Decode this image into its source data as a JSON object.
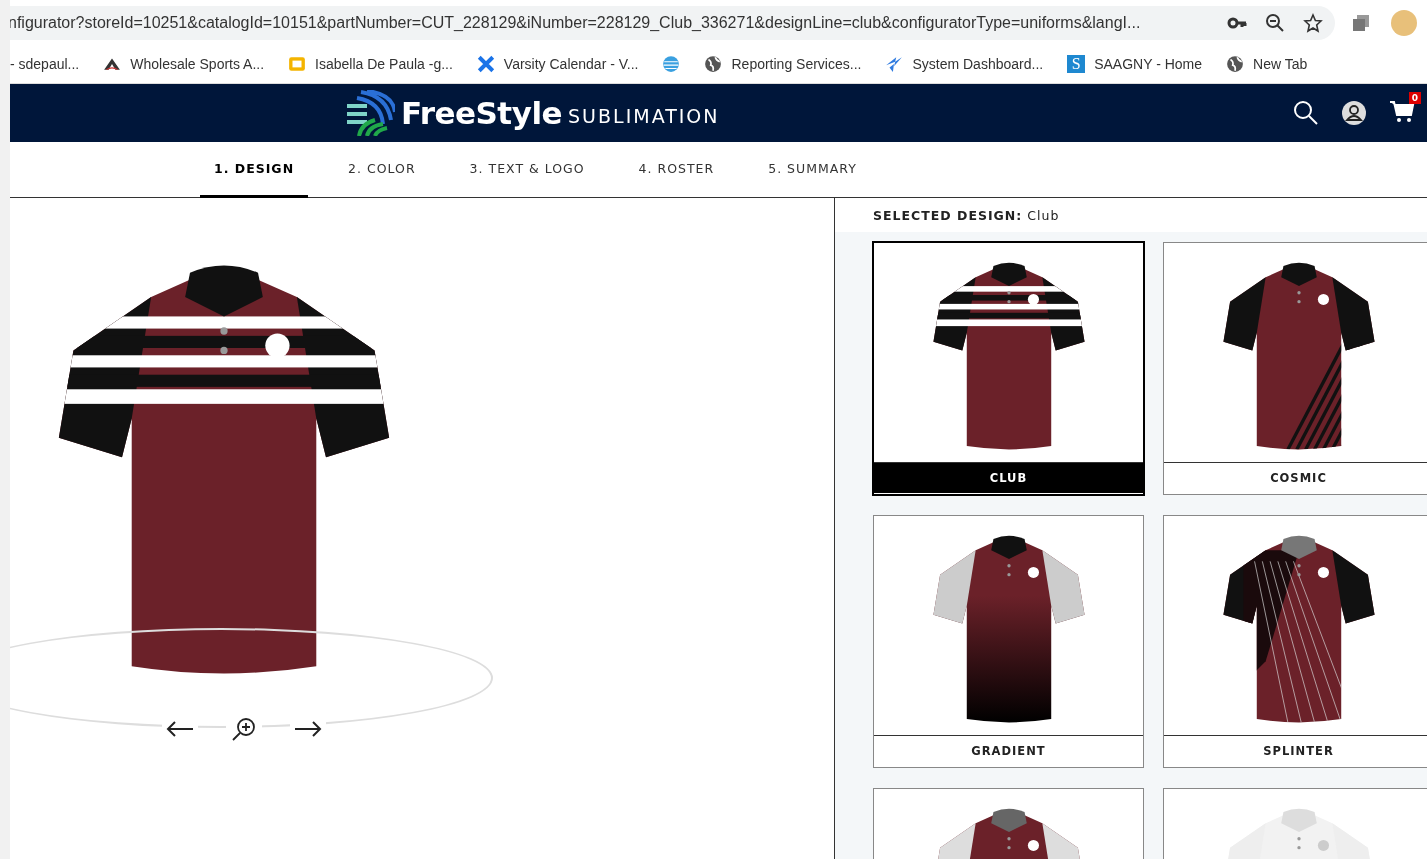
{
  "browser": {
    "url": "nfigurator?storeId=10251&catalogId=10151&partNumber=CUT_228129&iNumber=228129_Club_336271&designLine=club&configuratorType=uniforms&langI...",
    "bookmarks": [
      {
        "label": "- sdepaul...",
        "kind": "none"
      },
      {
        "label": "Wholesale Sports A...",
        "kind": "peak"
      },
      {
        "label": "Isabella De Paula -g...",
        "kind": "slides"
      },
      {
        "label": "Varsity Calendar - V...",
        "kind": "cross"
      },
      {
        "kind": "sphere"
      },
      {
        "label": "Reporting Services...",
        "kind": "globe"
      },
      {
        "label": "System Dashboard...",
        "kind": "bolt"
      },
      {
        "label": "SAAGNY - Home",
        "kind": "letter",
        "letter": "S"
      },
      {
        "label": "New Tab",
        "kind": "globe"
      }
    ]
  },
  "header": {
    "brand": "FreeStyle",
    "brand_suffix": "SUBLIMATION",
    "cart_count": "0"
  },
  "tabs": [
    {
      "label": "1. DESIGN",
      "selected": true
    },
    {
      "label": "2. COLOR",
      "selected": false
    },
    {
      "label": "3. TEXT & LOGO",
      "selected": false
    },
    {
      "label": "4. ROSTER",
      "selected": false
    },
    {
      "label": "5. SUMMARY",
      "selected": false
    }
  ],
  "selected_design": "**SELECTED DESIGN:** Club",
  "designs": [
    {
      "label": "CLUB",
      "kind": "stripes",
      "selected": true
    },
    {
      "label": "COSMIC",
      "kind": "cosmic",
      "selected": false
    },
    {
      "label": "GRADIENT",
      "kind": "gradient",
      "selected": false
    },
    {
      "label": "SPLINTER",
      "kind": "splinter",
      "selected": false
    },
    {
      "kind": "gray",
      "selected": false
    },
    {
      "kind": "white",
      "selected": false
    }
  ]
}
